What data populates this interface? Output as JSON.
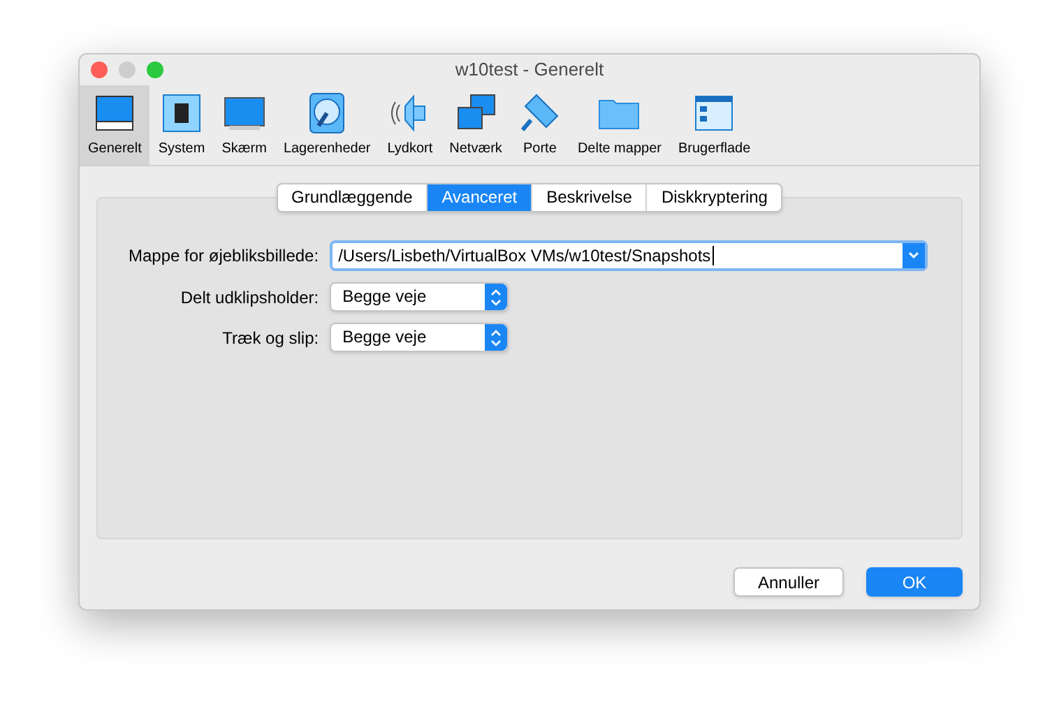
{
  "window": {
    "title": "w10test - Generelt"
  },
  "toolbar": [
    {
      "label": "Generelt",
      "kind": "general",
      "selected": true
    },
    {
      "label": "System",
      "kind": "chip",
      "selected": false
    },
    {
      "label": "Skærm",
      "kind": "display",
      "selected": false
    },
    {
      "label": "Lagerenheder",
      "kind": "disk",
      "selected": false
    },
    {
      "label": "Lydkort",
      "kind": "speaker",
      "selected": false
    },
    {
      "label": "Netværk",
      "kind": "network",
      "selected": false
    },
    {
      "label": "Porte",
      "kind": "port",
      "selected": false
    },
    {
      "label": "Delte mapper",
      "kind": "folder",
      "selected": false
    },
    {
      "label": "Brugerflade",
      "kind": "window",
      "selected": false
    }
  ],
  "tabs": [
    {
      "label": "Grundlæggende",
      "selected": false
    },
    {
      "label": "Avanceret",
      "selected": true
    },
    {
      "label": "Beskrivelse",
      "selected": false
    },
    {
      "label": "Diskkryptering",
      "selected": false
    }
  ],
  "fields": [
    {
      "kind": "combo",
      "label": "Mappe for øjebliksbillede:",
      "value": "/Users/Lisbeth/VirtualBox VMs/w10test/Snapshots"
    },
    {
      "kind": "popup",
      "label": "Delt udklipsholder:",
      "value": "Begge veje"
    },
    {
      "kind": "popup",
      "label": "Træk og slip:",
      "value": "Begge veje"
    }
  ],
  "buttons": [
    {
      "label": "Annuller",
      "kind": "default"
    },
    {
      "label": "OK",
      "kind": "primary"
    }
  ]
}
